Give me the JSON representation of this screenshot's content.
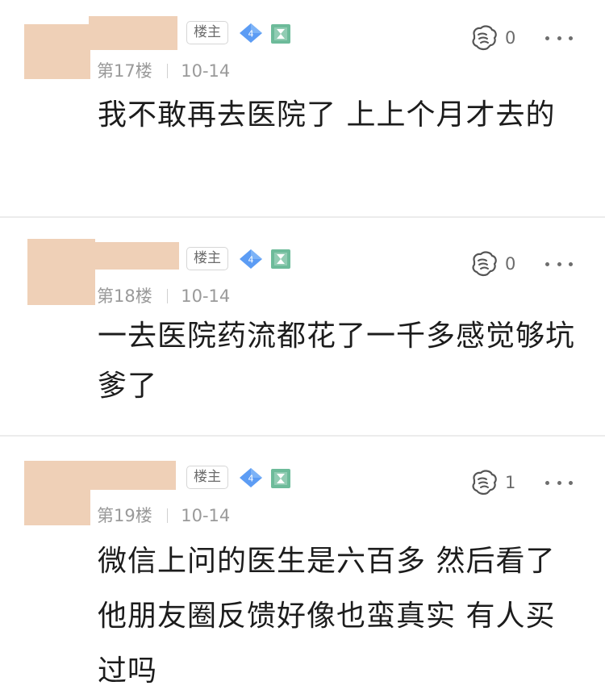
{
  "posts": [
    {
      "host_badge": "楼主",
      "level": "4",
      "floor": "第17楼",
      "date": "10-14",
      "like_count": "0",
      "content": "我不敢再去医院了 上上个月才去的"
    },
    {
      "host_badge": "楼主",
      "level": "4",
      "floor": "第18楼",
      "date": "10-14",
      "like_count": "0",
      "content": "一去医院药流都花了一千多感觉够坑爹了"
    },
    {
      "host_badge": "楼主",
      "level": "4",
      "floor": "第19楼",
      "date": "10-14",
      "like_count": "1",
      "content": "微信上问的医生是六百多 然后看了他朋友圈反馈好像也蛮真实 有人买过吗"
    }
  ],
  "icons": {
    "level": "diamond-level-icon",
    "medal": "medal-icon",
    "like": "like-hand-icon",
    "more": "more-icon"
  },
  "colors": {
    "avatar_blur": "#efd0b7",
    "level_blue": "#4a90f0",
    "medal_green": "#6dbb9a",
    "meta_gray": "#9a9a9a"
  }
}
